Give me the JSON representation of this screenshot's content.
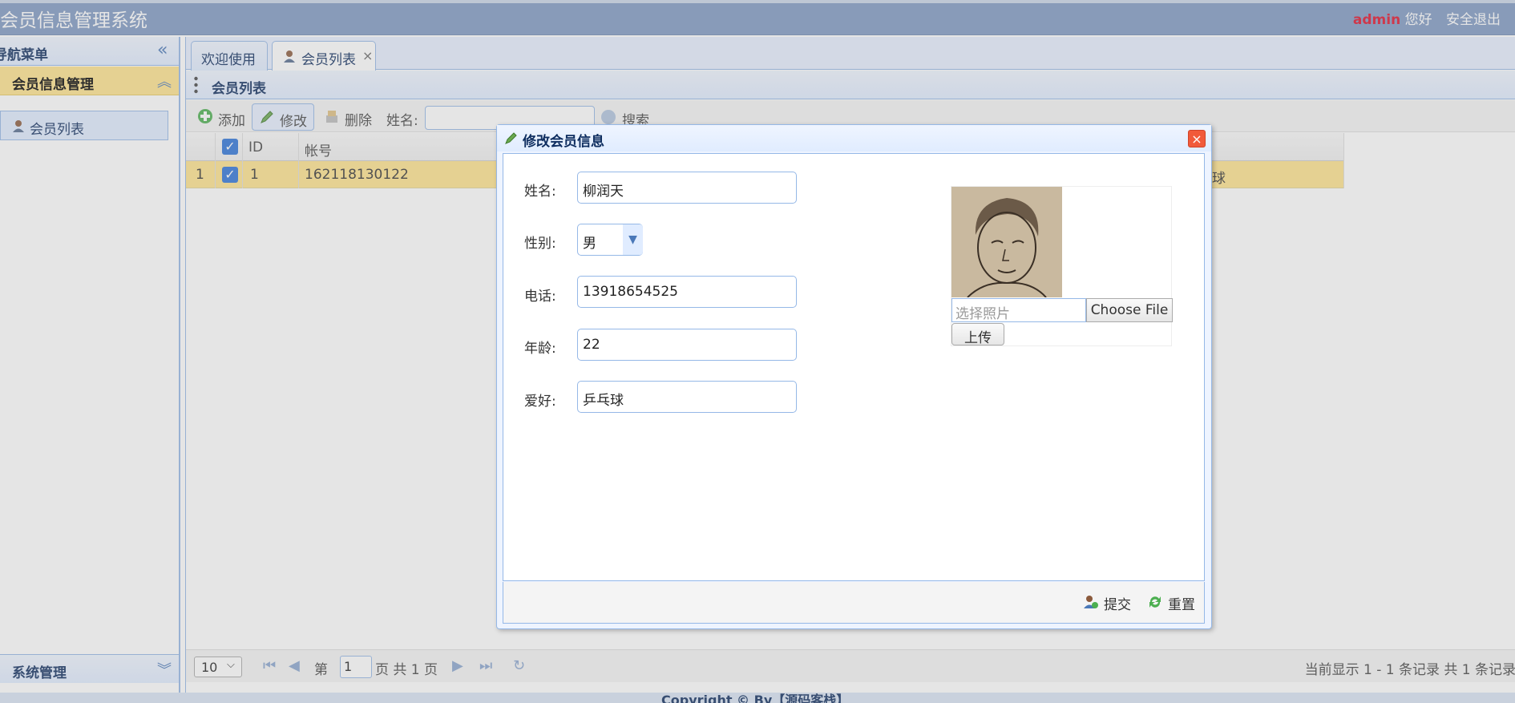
{
  "header": {
    "title": "会员信息管理系统",
    "user": "admin",
    "greeting": "您好",
    "logout": "安全退出"
  },
  "nav": {
    "title": "导航菜单",
    "group": "会员信息管理",
    "item": "会员列表",
    "footer_group": "系统管理"
  },
  "tabs": [
    {
      "label": "欢迎使用"
    },
    {
      "label": "会员列表",
      "close": "×"
    }
  ],
  "panel": {
    "title": "会员列表"
  },
  "toolbar": {
    "add": "添加",
    "edit": "修改",
    "delete": "删除",
    "search_label": "姓名:",
    "search_button": "搜索"
  },
  "grid": {
    "columns": [
      "ID",
      "帐号"
    ],
    "rows": [
      {
        "num": "1",
        "id": "1",
        "account": "162118130122",
        "hobby_fragment": "球"
      }
    ]
  },
  "pager": {
    "page_size": "10",
    "prefix": "第",
    "page": "1",
    "suffix": "页 共 1 页",
    "info": "当前显示 1 - 1 条记录 共 1 条记录"
  },
  "footer": {
    "text": "Copyright © By【源码客栈】"
  },
  "dialog": {
    "title": "修改会员信息",
    "close": "×",
    "fields": {
      "name_label": "姓名:",
      "name": "柳润天",
      "gender_label": "性别:",
      "gender": "男",
      "phone_label": "电话:",
      "phone": "13918654525",
      "age_label": "年龄:",
      "age": "22",
      "hobby_label": "爱好:",
      "hobby": "乒乓球"
    },
    "photo": {
      "placeholder": "选择照片",
      "choose": "Choose File",
      "upload": "上传"
    },
    "submit": "提交",
    "reset": "重置"
  },
  "colors": {
    "header": "#7f99c2",
    "selection": "#ffe48d",
    "panel_border": "#95b8e7",
    "admin": "#e0102a"
  }
}
